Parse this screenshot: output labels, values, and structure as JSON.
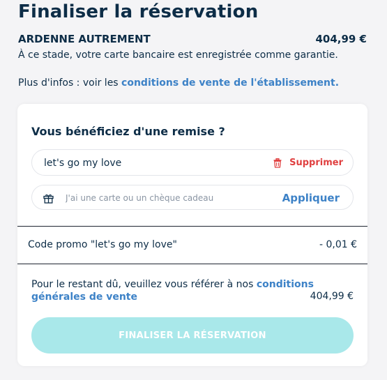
{
  "page": {
    "title": "Finaliser la réservation",
    "hotel_name": "ARDENNE AUTREMENT",
    "total_price": "404,99 €",
    "guarantee_text": "À ce stade, votre carte bancaire est enregistrée comme garantie.",
    "conditions_prefix": "Plus d'infos : voir les ",
    "conditions_link": "conditions de vente de l'établissement."
  },
  "discount": {
    "title": "Vous bénéficiez d'une remise ?",
    "promo_code_value": "let's go my love",
    "remove_label": "Supprimer",
    "gift_placeholder": "J'ai une carte ou un chèque cadeau",
    "apply_label": "Appliquer"
  },
  "summary": {
    "promo_label": "Code promo \"let's go my love\"",
    "promo_amount": "- 0,01 €",
    "remaining_prefix": "Pour le restant dû, veuillez vous référer à nos ",
    "remaining_link": "conditions générales de vente",
    "remaining_amount": "404,99 €"
  },
  "actions": {
    "finalize_label": "FINALISER LA RÉSERVATION"
  },
  "colors": {
    "text": "#0d2d47",
    "link": "#3d82c7",
    "danger": "#e04040",
    "button_disabled": "#a9e8ea"
  },
  "icons": {
    "remove": "trash-icon",
    "gift": "gift-icon"
  }
}
